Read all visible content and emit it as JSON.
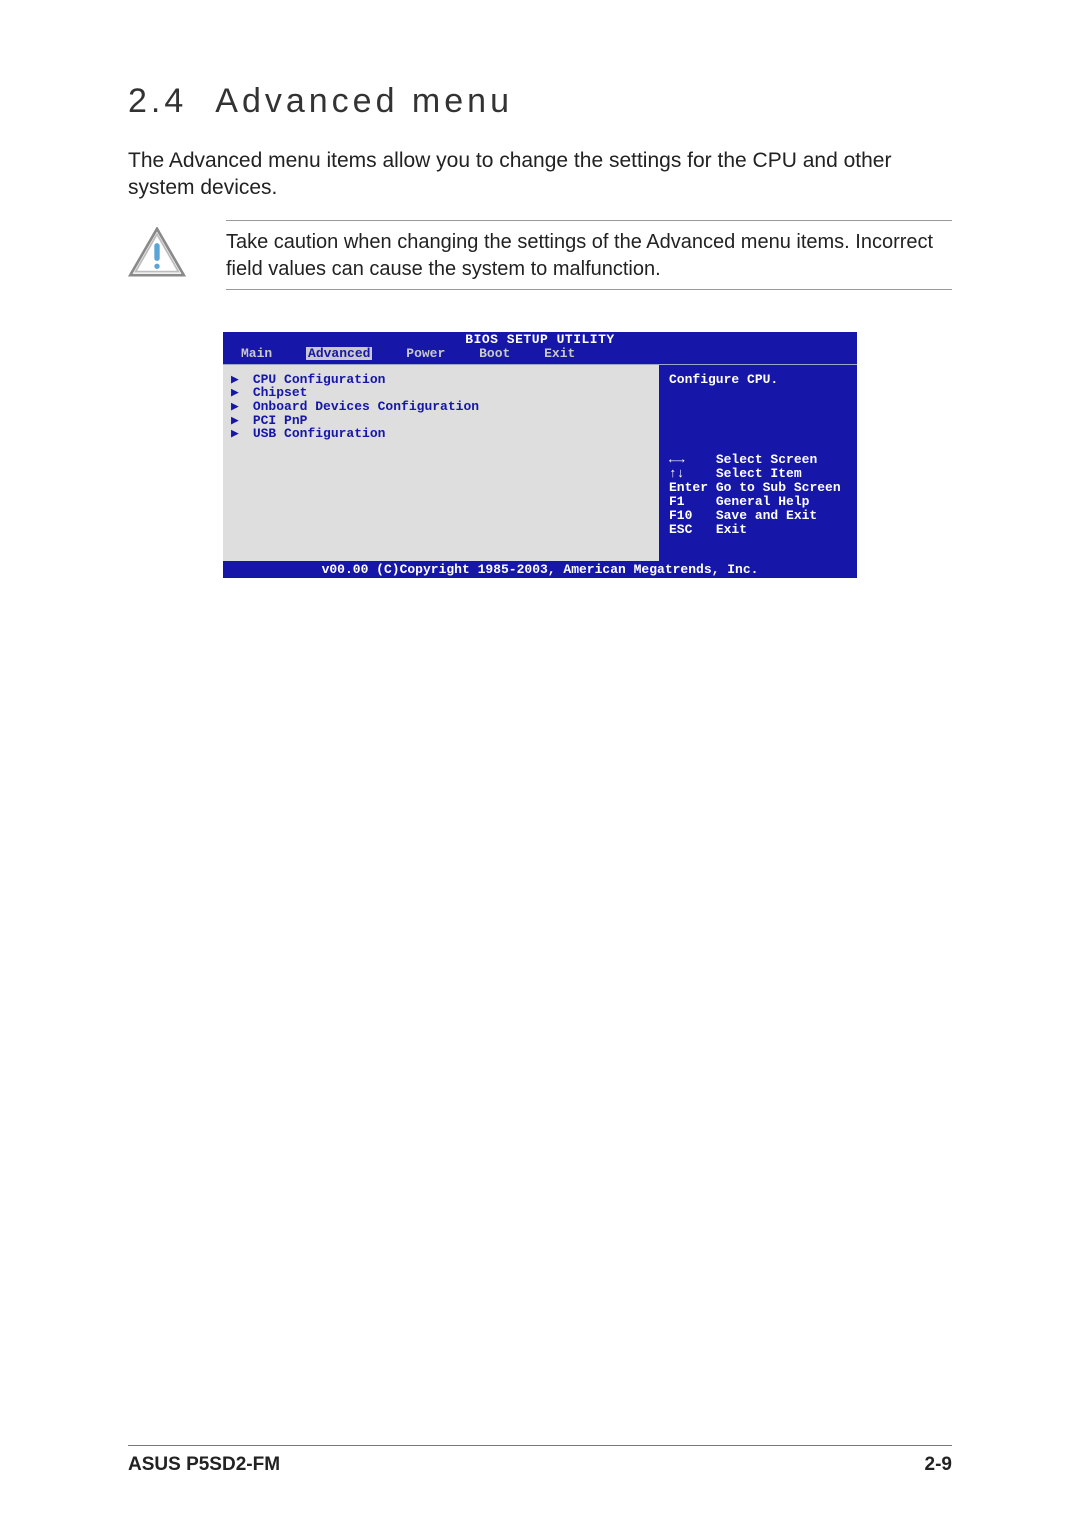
{
  "heading": {
    "number": "2.4",
    "title": "Advanced menu"
  },
  "intro": "The Advanced menu items allow you to change the settings for the CPU and other system devices.",
  "caution": "Take caution when changing the settings of the Advanced menu items. Incorrect field values can cause the system to malfunction.",
  "bios": {
    "title": "BIOS SETUP UTILITY",
    "tabs": [
      "Main",
      "Advanced",
      "Power",
      "Boot",
      "Exit"
    ],
    "selected_tab": "Advanced",
    "items": [
      "CPU Configuration",
      "Chipset",
      "Onboard Devices Configuration",
      "PCI PnP",
      "USB Configuration"
    ],
    "help_top": "Configure CPU.",
    "help_keys": [
      {
        "key": "←→",
        "desc": "Select Screen"
      },
      {
        "key": "↑↓",
        "desc": "Select Item"
      },
      {
        "key": "Enter",
        "desc": "Go to Sub Screen"
      },
      {
        "key": "F1",
        "desc": "General Help"
      },
      {
        "key": "F10",
        "desc": "Save and Exit"
      },
      {
        "key": "ESC",
        "desc": "Exit"
      }
    ],
    "footer": "v00.00 (C)Copyright 1985-2003, American Megatrends, Inc."
  },
  "page_footer": {
    "left": "ASUS P5SD2-FM",
    "right": "2-9"
  }
}
